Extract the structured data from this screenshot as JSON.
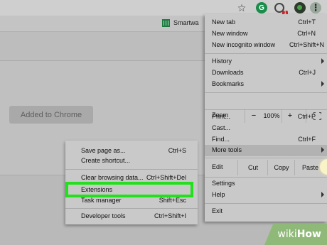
{
  "toolbar": {
    "star_icon": "star-icon",
    "grammarly_letter": "G",
    "extension_badge": "1",
    "menu_glyph": "⋮"
  },
  "bookmarks": {
    "item_label": "Smartwa"
  },
  "page": {
    "added_button_label": "Added to Chrome"
  },
  "menu": {
    "items": [
      {
        "label": "New tab",
        "shortcut": "Ctrl+T"
      },
      {
        "label": "New window",
        "shortcut": "Ctrl+N"
      },
      {
        "label": "New incognito window",
        "shortcut": "Ctrl+Shift+N"
      },
      {
        "label": "History",
        "shortcut": ""
      },
      {
        "label": "Downloads",
        "shortcut": "Ctrl+J"
      },
      {
        "label": "Bookmarks",
        "shortcut": ""
      },
      {
        "label": "Print...",
        "shortcut": "Ctrl+P"
      },
      {
        "label": "Cast...",
        "shortcut": ""
      },
      {
        "label": "Find...",
        "shortcut": "Ctrl+F"
      },
      {
        "label": "More tools",
        "shortcut": ""
      },
      {
        "label": "Settings",
        "shortcut": ""
      },
      {
        "label": "Help",
        "shortcut": ""
      },
      {
        "label": "Exit",
        "shortcut": ""
      }
    ],
    "zoom": {
      "label": "Zoom",
      "minus": "−",
      "value": "100%",
      "plus": "+"
    },
    "edit": {
      "label": "Edit",
      "cut": "Cut",
      "copy": "Copy",
      "paste": "Paste"
    }
  },
  "submenu": {
    "items": [
      {
        "label": "Save page as...",
        "shortcut": "Ctrl+S"
      },
      {
        "label": "Create shortcut...",
        "shortcut": ""
      },
      {
        "label": "Clear browsing data...",
        "shortcut": "Ctrl+Shift+Del"
      },
      {
        "label": "Extensions",
        "shortcut": ""
      },
      {
        "label": "Task manager",
        "shortcut": "Shift+Esc"
      },
      {
        "label": "Developer tools",
        "shortcut": "Ctrl+Shift+I"
      }
    ]
  },
  "watermark": {
    "part1": "wiki",
    "part2": "How"
  },
  "colors": {
    "highlight": "#22e01c",
    "grammarly": "#1a8d4a",
    "badge": "#c5282a"
  }
}
